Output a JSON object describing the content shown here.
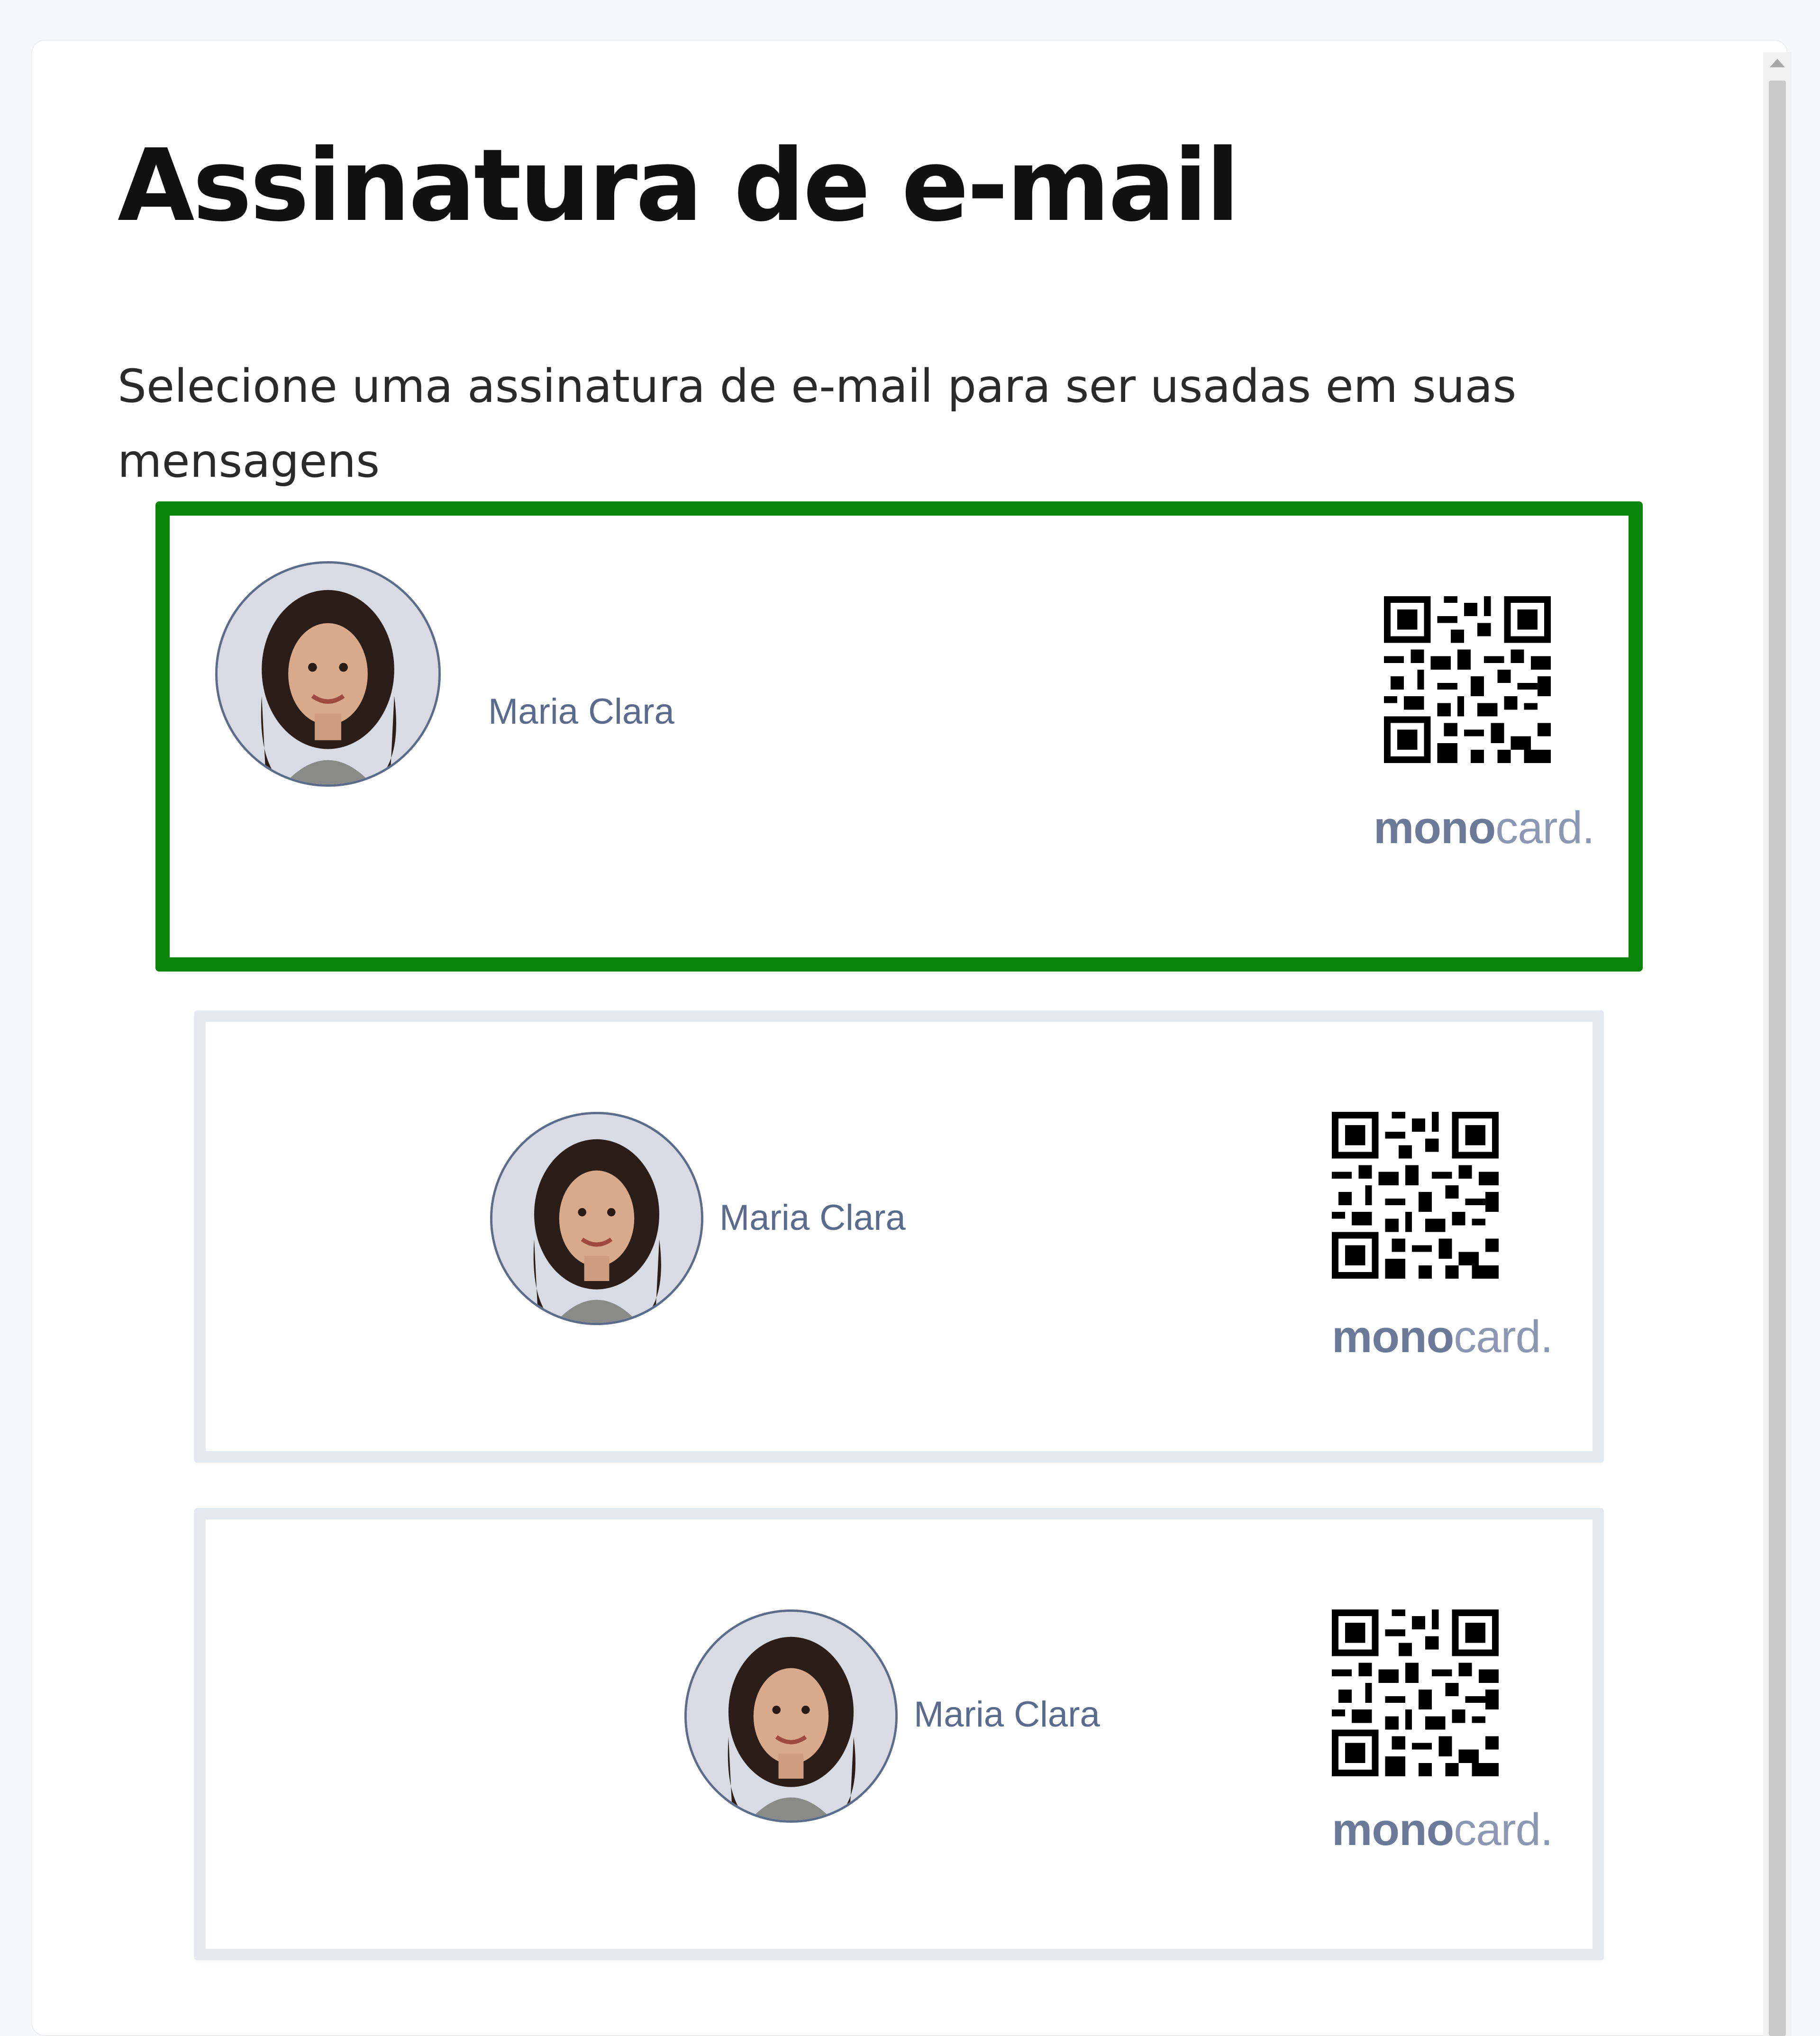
{
  "dialog": {
    "title": "Assinatura de e-mail",
    "subtitle": "Selecione uma assinatura de e-mail para ser usadas em suas mensagens"
  },
  "signatures": [
    {
      "name": "Maria Clara",
      "brand_bold": "mono",
      "brand_thin": "card.",
      "selected": true,
      "avatar_icon": "person-photo",
      "qr_icon": "qr-code"
    },
    {
      "name": "Maria Clara",
      "brand_bold": "mono",
      "brand_thin": "card.",
      "selected": false,
      "avatar_icon": "person-photo",
      "qr_icon": "qr-code"
    },
    {
      "name": "Maria Clara",
      "brand_bold": "mono",
      "brand_thin": "card.",
      "selected": false,
      "avatar_icon": "person-photo",
      "qr_icon": "qr-code"
    }
  ],
  "colors": {
    "selected_border": "#088408",
    "card_border": "#e4e9f0",
    "name_text": "#5b6b8e",
    "brand_text": "#6c7a99"
  }
}
